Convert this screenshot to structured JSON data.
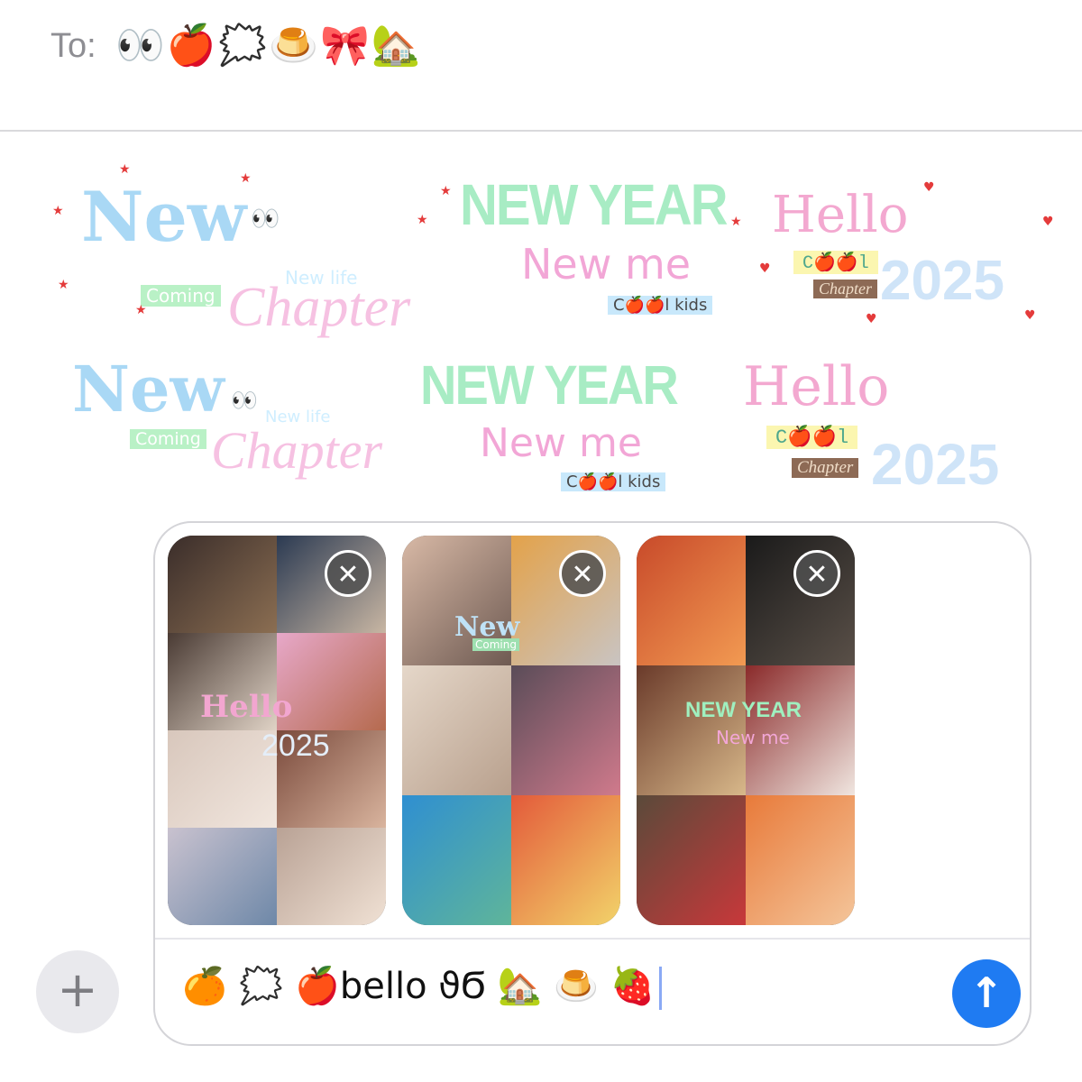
{
  "header": {
    "to_label": "To:",
    "recipient": "👀🍎🗯️🍮🎀🏡"
  },
  "stickers": {
    "row1": [
      {
        "title": "New",
        "eyes": "👀",
        "tag": "Coming",
        "sub": "New life",
        "script": "Chapter"
      },
      {
        "title": "NEW YEAR",
        "sub": "New me",
        "tag": "C🍎🍎l kids"
      },
      {
        "title": "Hello",
        "tag1": "C🍎🍎l",
        "tag2": "Chapter",
        "year": "2025"
      }
    ],
    "row2": [
      {
        "title": "New",
        "eyes": "👀",
        "tag": "Coming",
        "sub": "New life",
        "script": "Chapter"
      },
      {
        "title": "NEW YEAR",
        "sub": "New me",
        "tag": "C🍎🍎l kids"
      },
      {
        "title": "Hello",
        "tag1": "C🍎🍎l",
        "tag2": "Chapter",
        "year": "2025"
      }
    ]
  },
  "attachments": [
    {
      "name": "collage-1",
      "overlay_title": "Hello",
      "overlay_sub": "2025",
      "close": "✕"
    },
    {
      "name": "collage-2",
      "overlay_title": "New",
      "overlay_sub": "Coming",
      "close": "✕"
    },
    {
      "name": "collage-3",
      "overlay_title": "NEW YEAR",
      "overlay_sub": "New me",
      "close": "✕"
    }
  ],
  "composer": {
    "message_text": "🍊 🗯️ 🍎bello ϑϬ 🏡 🍮 🍓",
    "send_icon": "↑",
    "plus_icon": "+"
  },
  "colors": {
    "send_button": "#1f7bf2",
    "border": "#d4d4d8"
  }
}
